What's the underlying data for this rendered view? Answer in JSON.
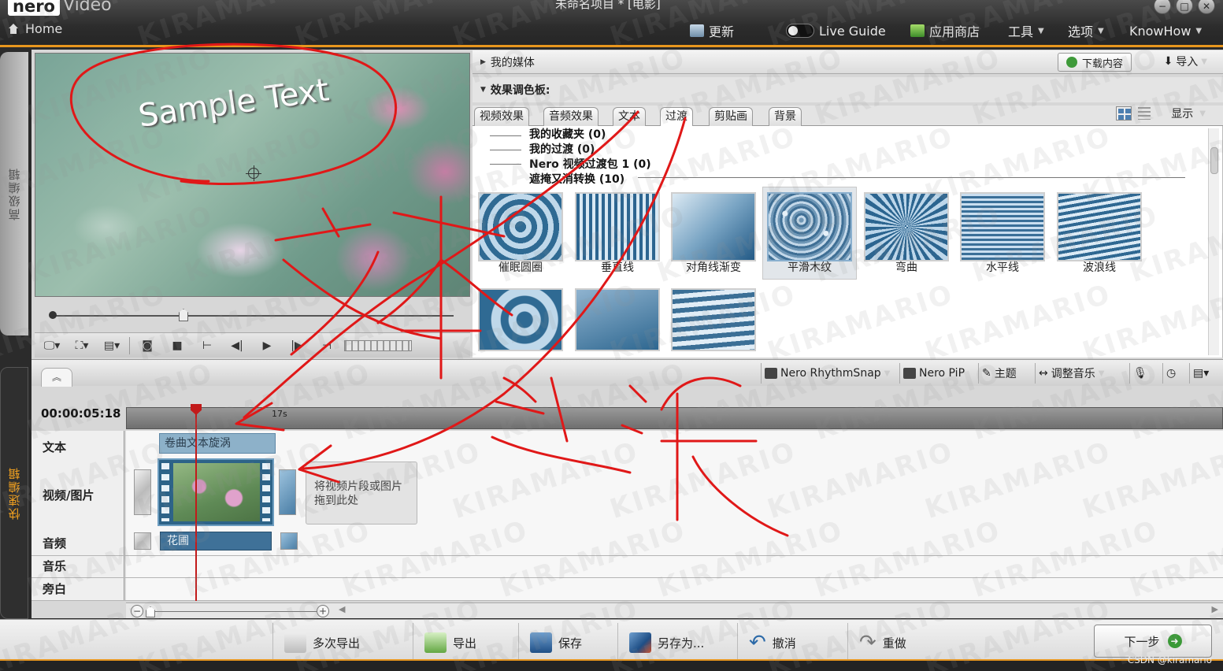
{
  "window": {
    "logo": "nero",
    "app_name": "Video",
    "title": "未命名项目 * [电影]",
    "controls": [
      "−",
      "□",
      "✕"
    ]
  },
  "nav": {
    "home": "Home",
    "update": "更新",
    "live_guide": "Live Guide",
    "app_store": "应用商店",
    "tools": "工具",
    "options": "选项",
    "knowhow": "KnowHow"
  },
  "side_tabs": {
    "advanced": "高级编辑",
    "express": "快速编辑"
  },
  "preview": {
    "overlay_text": "Sample Text"
  },
  "media": {
    "my_media": "我的媒体",
    "download": "下载内容",
    "import": "导入"
  },
  "effects": {
    "header": "效果调色板:",
    "tabs": [
      "视频效果",
      "音频效果",
      "文本",
      "过渡",
      "剪贴画",
      "背景"
    ],
    "active_tab": "过渡",
    "display": "显示",
    "categories": [
      "我的收藏夹 (0)",
      "我的过渡 (0)",
      "Nero 视频过渡包 1 (0)",
      "遮掩又消转换 (10)"
    ],
    "items": [
      {
        "label": "催眠圆圈",
        "pattern": "hypnotic-circles"
      },
      {
        "label": "垂直线",
        "pattern": "vertical-lines"
      },
      {
        "label": "对角线渐变",
        "pattern": "diagonal-gradient"
      },
      {
        "label": "平滑木纹",
        "pattern": "smooth-wood-grain",
        "selected": true
      },
      {
        "label": "弯曲",
        "pattern": "bend"
      },
      {
        "label": "水平线",
        "pattern": "horizontal-lines"
      },
      {
        "label": "波浪线",
        "pattern": "wavy-lines"
      },
      {
        "label": "",
        "pattern": "swirl"
      },
      {
        "label": "",
        "pattern": "plain-gradient"
      },
      {
        "label": "",
        "pattern": "wave-2"
      }
    ]
  },
  "timeline_tools": {
    "rhythmsnap": "Nero RhythmSnap",
    "pip": "Nero PiP",
    "theme": "主题",
    "adjust_music": "调整音乐"
  },
  "timeline": {
    "timecode": "00:00:05:18",
    "ruler_label": "17s",
    "tracks": [
      "文本",
      "视频/图片",
      "音频",
      "音乐",
      "旁白"
    ],
    "text_clip": "卷曲文本旋涡",
    "drop_hint_line1": "将视频片段或图片",
    "drop_hint_line2": "拖到此处",
    "audio_clip": "花圃"
  },
  "actions": {
    "multi_export": "多次导出",
    "export": "导出",
    "save": "保存",
    "save_as": "另存为...",
    "undo": "撤消",
    "redo": "重做",
    "next": "下一步"
  },
  "credit": "CSDN @kiramario",
  "watermark": "KIRAMARIO",
  "colors": {
    "accent_orange": "#e8961e",
    "annotation_red": "#e01818",
    "clip_blue": "#3f7198",
    "playhead_red": "#c21a1a"
  }
}
